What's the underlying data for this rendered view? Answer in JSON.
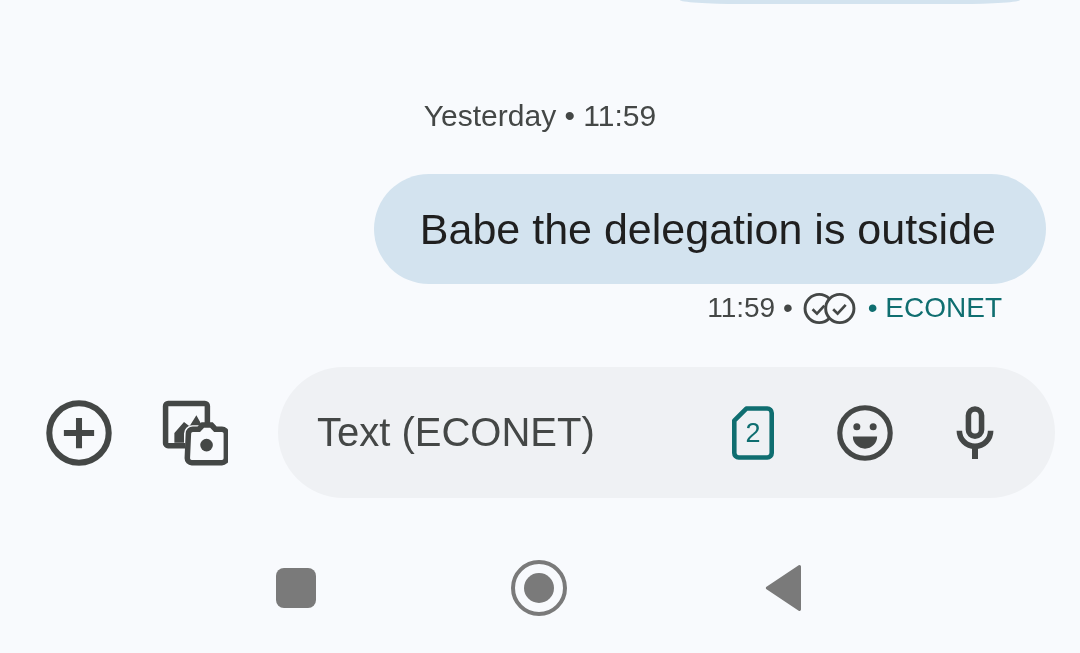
{
  "conversation": [
    {
      "kind": "clipped_bubble"
    },
    {
      "kind": "timestamp",
      "text": "Yesterday • 11:59"
    },
    {
      "kind": "sent",
      "text": "Babe the delegation is outside",
      "time": "11:59 •",
      "delivered": true,
      "carrier": "• ECONET"
    }
  ],
  "compose": {
    "placeholder": "Text (ECONET)",
    "sim_slot": "2"
  }
}
